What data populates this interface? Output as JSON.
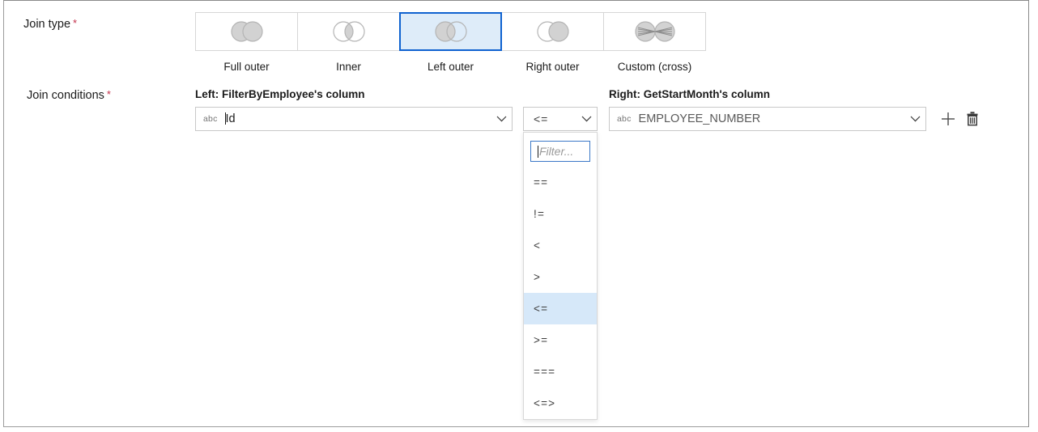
{
  "form": {
    "join_type_label": "Join type",
    "join_conditions_label": "Join conditions",
    "required_marker": "*"
  },
  "join_type": {
    "selected": "Left outer",
    "options": [
      {
        "label": "Full outer",
        "icon": "venn-full-outer-icon",
        "selected": false
      },
      {
        "label": "Inner",
        "icon": "venn-inner-icon",
        "selected": false
      },
      {
        "label": "Left outer",
        "icon": "venn-left-outer-icon",
        "selected": true
      },
      {
        "label": "Right outer",
        "icon": "venn-right-outer-icon",
        "selected": false
      },
      {
        "label": "Custom (cross)",
        "icon": "venn-cross-join-icon",
        "selected": false
      }
    ]
  },
  "join_conditions": {
    "left_header": "Left: FilterByEmployee's column",
    "right_header": "Right: GetStartMonth's column",
    "left_column": {
      "type_badge": "abc",
      "value": "Id",
      "chevron": "chevron-down-icon"
    },
    "operator": {
      "value": "<=",
      "chevron": "chevron-down-icon"
    },
    "right_column": {
      "type_badge": "abc",
      "value": "EMPLOYEE_NUMBER",
      "chevron": "chevron-down-icon"
    },
    "add_icon": "plus-icon",
    "delete_icon": "trash-icon"
  },
  "operator_dropdown": {
    "filter_placeholder": "Filter...",
    "filter_value": "",
    "selected": "<=",
    "items": [
      "==",
      "!=",
      "<",
      ">",
      "<=",
      ">=",
      "===",
      "<=>"
    ]
  },
  "colors": {
    "accent": "#0f62d0",
    "selected_tile_bg": "#deecf9",
    "highlight_row": "#d6e8f9",
    "required_star": "#c4314b",
    "venn_fill": "#d2d2d2",
    "venn_stroke": "#b4b4b4"
  }
}
